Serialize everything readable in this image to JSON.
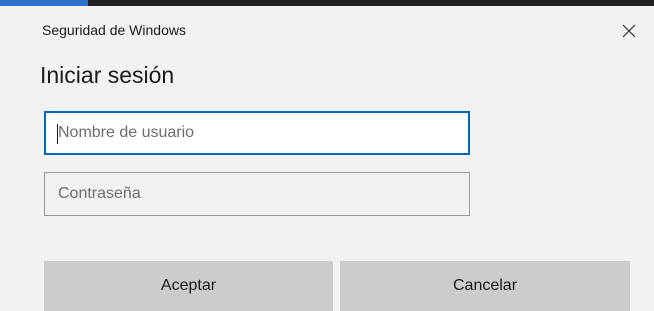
{
  "window": {
    "title": "Seguridad de Windows",
    "close_icon": "close-icon"
  },
  "dialog": {
    "heading": "Iniciar sesión"
  },
  "fields": {
    "username_placeholder": "Nombre de usuario",
    "username_value": "",
    "password_placeholder": "Contraseña",
    "password_value": ""
  },
  "buttons": {
    "accept_label": "Aceptar",
    "cancel_label": "Cancelar"
  },
  "colors": {
    "focus_border": "#0067c0",
    "background": "#f2f2f2",
    "button_bg": "#cccccc",
    "taskbar_accent": "#2f6fc8"
  }
}
